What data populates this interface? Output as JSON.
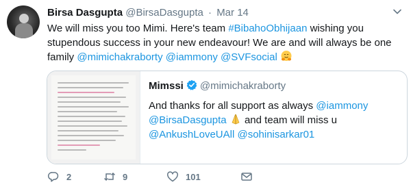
{
  "tweet": {
    "author_name": "Birsa Dasgupta",
    "author_handle": "@BirsaDasgupta",
    "separator": "·",
    "date": "Mar 14",
    "text_part1": "We will miss you too Mimi. Here's team ",
    "hashtag": "#BibahoObhijaan",
    "text_part2": " wishing you stupendous success in your new endeavour! We are and will always be one family ",
    "mention1": "@mimichakraborty",
    "mention2": "@iammony",
    "mention3": "@SVFsocial",
    "emoji_name": "hugging-face-emoji"
  },
  "quoted": {
    "name": "Mimssi",
    "handle": "@mimichakraborty",
    "verified_icon": "verified-badge-icon",
    "text_part1": "And thanks for all support as always ",
    "mention1": "@iammony",
    "mention2": "@BirsaDasgupta",
    "emoji_name": "folded-hands-emoji",
    "text_part2": " and  team will miss u ",
    "mention3": "@AnkushLoveUAll",
    "mention4": "@sohinisarkar01",
    "image_label": "statement-image"
  },
  "actions": {
    "reply_count": "2",
    "retweet_count": "9",
    "like_count": "101"
  },
  "colors": {
    "link": "#1b95e0",
    "muted": "#657786",
    "verified": "#1da1f2",
    "border": "#ccd6dd"
  }
}
